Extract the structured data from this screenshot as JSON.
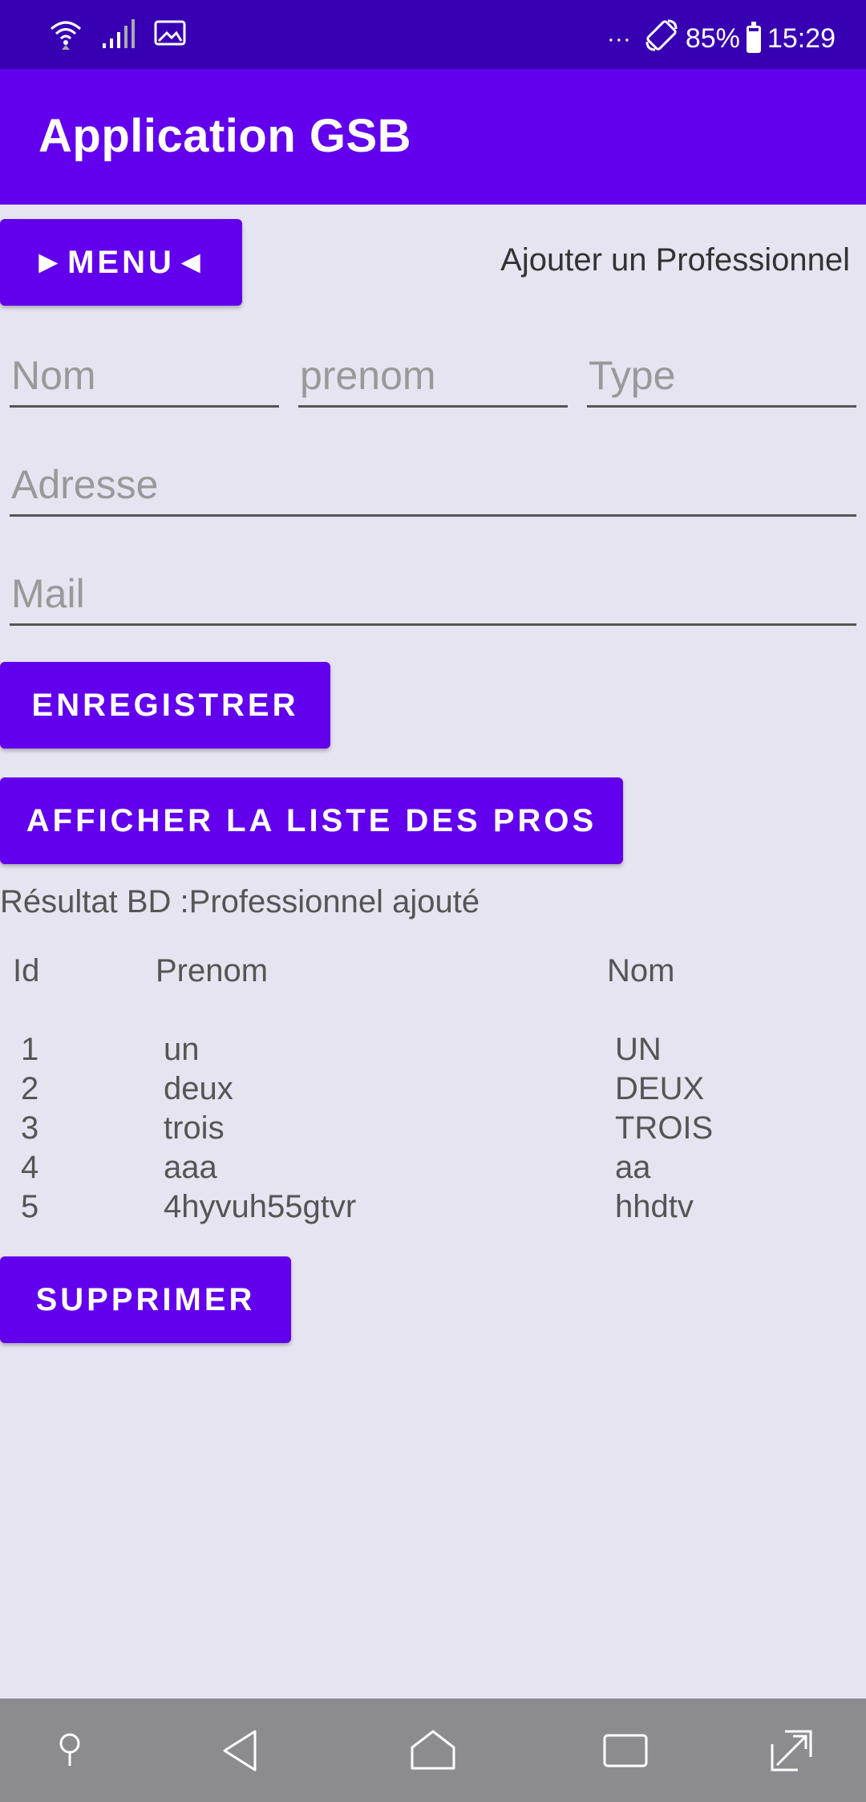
{
  "status_bar": {
    "icons": [
      "wifi-icon",
      "signal-icon",
      "image-icon"
    ],
    "more": "···",
    "battery_percent": "85%",
    "time": "15:29"
  },
  "app_bar": {
    "title": "Application GSB"
  },
  "menu_button": {
    "label": "►MENU◄"
  },
  "page_subtitle": "Ajouter un Professionnel",
  "form": {
    "nom": {
      "placeholder": "Nom",
      "value": ""
    },
    "prenom": {
      "placeholder": "prenom",
      "value": ""
    },
    "type": {
      "placeholder": "Type",
      "value": ""
    },
    "adresse": {
      "placeholder": "Adresse",
      "value": ""
    },
    "mail": {
      "placeholder": "Mail",
      "value": ""
    }
  },
  "buttons": {
    "save": "ENREGISTRER",
    "list": "AFFICHER LA LISTE DES PROS",
    "delete": "SUPPRIMER"
  },
  "result_text": "Résultat BD :Professionnel ajouté",
  "table": {
    "headers": {
      "id": "Id",
      "prenom": "Prenom",
      "nom": "Nom"
    },
    "rows": [
      {
        "id": "1",
        "prenom": "un",
        "nom": "UN"
      },
      {
        "id": "2",
        "prenom": "deux",
        "nom": "DEUX"
      },
      {
        "id": "3",
        "prenom": "trois",
        "nom": "TROIS"
      },
      {
        "id": "4",
        "prenom": "aaa",
        "nom": "aa"
      },
      {
        "id": "5",
        "prenom": "4hyvuh55gtvr",
        "nom": "hhdtv"
      }
    ]
  },
  "nav_bar": {
    "icons": [
      "pin-icon",
      "back-icon",
      "home-icon",
      "recents-icon",
      "expand-icon"
    ]
  },
  "colors": {
    "status_bar": "#3700B3",
    "primary": "#6200EE",
    "background": "#E6E4F0",
    "nav_bar": "#8C8B90"
  }
}
